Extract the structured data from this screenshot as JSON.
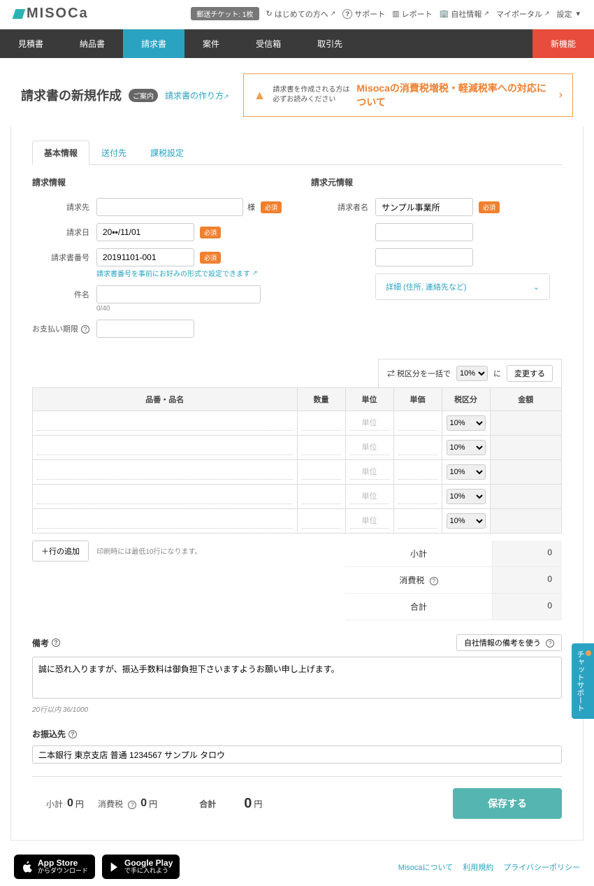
{
  "brand": "MISOCa",
  "topbar": {
    "ticket": "郵送チケット: 1枚",
    "firstTime": "はじめての方へ",
    "support": "サポート",
    "report": "レポート",
    "company": "自社情報",
    "portal": "マイポータル",
    "settings": "設定"
  },
  "nav": {
    "estimate": "見積書",
    "delivery": "納品書",
    "invoice": "請求書",
    "project": "案件",
    "inbox": "受信箱",
    "contacts": "取引先",
    "newFeature": "新機能"
  },
  "page": {
    "title": "請求書の新規作成",
    "guideBadge": "ご案内",
    "guideLink": "請求書の作り方",
    "bannerNote1": "請求書を作成される方は",
    "bannerNote2": "必ずお読みください",
    "bannerMain": "Misocaの消費税増税・軽減税率への対応について"
  },
  "tabs": {
    "basic": "基本情報",
    "dest": "送付先",
    "tax": "課税設定"
  },
  "left": {
    "heading": "請求情報",
    "clientLabel": "請求先",
    "clientSuffix": "様",
    "dateLabel": "請求日",
    "dateValue": "20▪▪/11/01",
    "numLabel": "請求書番号",
    "numValue": "20191101-001",
    "numHint": "請求書番号を事前にお好みの形式で設定できます",
    "subjectLabel": "件名",
    "subjectCount": "0/40",
    "dueLabel": "お支払い期限",
    "reqBadge": "必須"
  },
  "right": {
    "heading": "請求元情報",
    "nameLabel": "請求者名",
    "nameValue": "サンプル事業所",
    "detailsToggle": "詳細 (住所, 連絡先など)"
  },
  "bulk": {
    "prefix": "⇄ 税区分を一括で",
    "rate": "10%",
    "mid": "に",
    "btn": "変更する"
  },
  "table": {
    "headers": {
      "name": "品番・品名",
      "qty": "数量",
      "unit": "単位",
      "price": "単価",
      "tax": "税区分",
      "amount": "金額"
    },
    "unitPlaceholder": "単位",
    "rowTax": "10%",
    "addRow": "行の追加",
    "addRowNote": "印刷時には最低10行になります。"
  },
  "totals": {
    "subtotal": "小計",
    "subtotalVal": "0",
    "tax": "消費税",
    "taxVal": "0",
    "grand": "合計",
    "grandVal": "0"
  },
  "remarks": {
    "label": "備考",
    "useCompany": "自社情報の備考を使う",
    "value": "誠に恐れ入りますが、振込手数料は御負担下さいますようお願い申し上げます。",
    "count": "20行以内 36/1000"
  },
  "bank": {
    "label": "お振込先",
    "value": "二本銀行 東京支店 普通 1234567 サンプル タロウ"
  },
  "footer": {
    "sub": "小計",
    "subVal": "0",
    "yen": "円",
    "tax": "消費税",
    "taxVal": "0",
    "grand": "合計",
    "grandVal": "0",
    "save": "保存する"
  },
  "stores": {
    "apple1": "App Store",
    "apple2": "からダウンロード",
    "google1": "Google Play",
    "google2": "で手に入れよう",
    "about": "Misocaについて",
    "terms": "利用規約",
    "privacy": "プライバシーポリシー"
  },
  "chat": "チャットサポート"
}
